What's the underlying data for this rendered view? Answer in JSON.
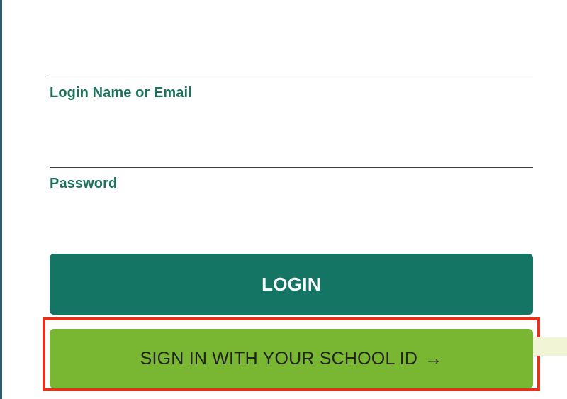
{
  "form": {
    "login_field": {
      "label": "Login Name or Email",
      "value": "",
      "placeholder": ""
    },
    "password_field": {
      "label": "Password",
      "value": "",
      "placeholder": ""
    },
    "login_button": {
      "label": "LOGIN"
    },
    "school_id_button": {
      "label": "SIGN IN WITH YOUR SCHOOL ID",
      "arrow": "→"
    }
  },
  "colors": {
    "brand_dark_green": "#147565",
    "label_green": "#1d7360",
    "school_button_green": "#79b732",
    "highlight_red": "#e5301e"
  },
  "icons": {
    "school_button_arrow": "right-arrow-icon"
  }
}
